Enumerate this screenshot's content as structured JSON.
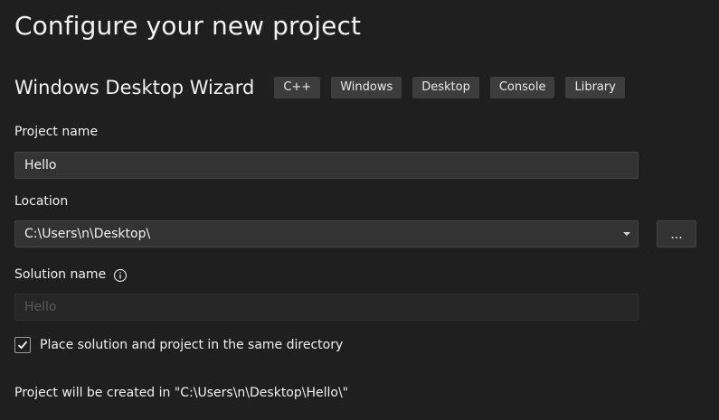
{
  "page": {
    "title": "Configure your new project"
  },
  "template": {
    "name": "Windows Desktop Wizard",
    "tags": [
      "C++",
      "Windows",
      "Desktop",
      "Console",
      "Library"
    ]
  },
  "project_name": {
    "label": "Project name",
    "value": "Hello"
  },
  "location": {
    "label": "Location",
    "value": "C:\\Users\\n\\Desktop\\",
    "browse_label": "..."
  },
  "solution_name": {
    "label": "Solution name",
    "value": "Hello",
    "info_icon": "info-circle-icon",
    "disabled": true
  },
  "same_directory": {
    "label": "Place solution and project in the same directory",
    "checked": true
  },
  "footer": {
    "created_in": "Project will be created in \"C:\\Users\\n\\Desktop\\Hello\\\""
  },
  "colors": {
    "background": "#1f1f1f",
    "input_background": "#333333",
    "tag_background": "#3d3d3d",
    "text": "#f1f1f1",
    "disabled_text": "#5a5a5a"
  }
}
